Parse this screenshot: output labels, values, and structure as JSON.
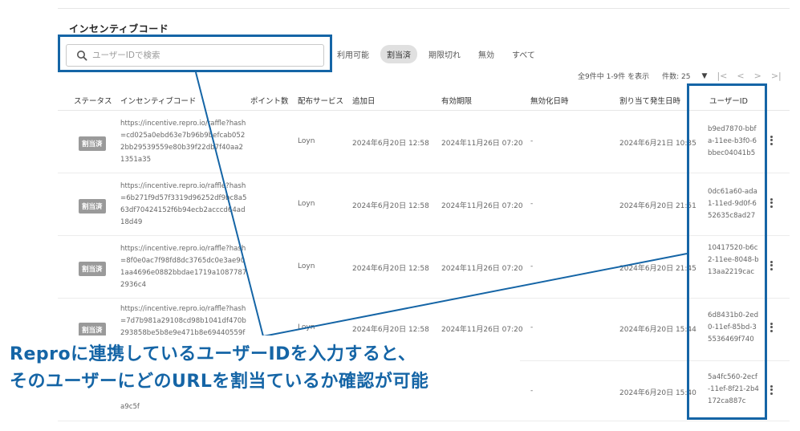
{
  "page": {
    "title": "インセンティブコード"
  },
  "search": {
    "placeholder": "ユーザーIDで検索",
    "value": ""
  },
  "filters": [
    {
      "label": "利用可能",
      "active": false
    },
    {
      "label": "割当済",
      "active": true
    },
    {
      "label": "期限切れ",
      "active": false
    },
    {
      "label": "無効",
      "active": false
    },
    {
      "label": "すべて",
      "active": false
    }
  ],
  "pager": {
    "summary": "全9件中 1-9件 を表示",
    "per_page_label": "件数: 25",
    "dropdown_icon": "chevron-down-icon",
    "first": "|<",
    "prev": "<",
    "next": ">",
    "last": ">|"
  },
  "columns": {
    "status": "ステータス",
    "code": "インセンティブコード",
    "points": "ポイント数",
    "service": "配布サービス",
    "added": "追加日",
    "expiry": "有効期限",
    "disabled": "無効化日時",
    "assigned": "割り当て発生日時",
    "user_id": "ユーザーID"
  },
  "rows": [
    {
      "status": "割当済",
      "url": "https://incentive.repro.io/raffle?hash=cd025a0ebd63e7b96b9befcab0522bb29539559e80b39f22db7f40aa21351a35",
      "points": "",
      "service": "Loyn",
      "added": "2024年6月20日 12:58",
      "expiry": "2024年11月26日 07:20",
      "disabled": "-",
      "assigned": "2024年6月21日 10:35",
      "user_id": "b9ed7870-bbfa-11ee-b3f0-6bbec04041b5"
    },
    {
      "status": "割当済",
      "url": "https://incentive.repro.io/raffle?hash=6b271f9d57f3319d96252df9bc8a563df70424152f6b94ecb2acccd64ad18d49",
      "points": "",
      "service": "Loyn",
      "added": "2024年6月20日 12:58",
      "expiry": "2024年11月26日 07:20",
      "disabled": "-",
      "assigned": "2024年6月20日 21:51",
      "user_id": "0dc61a60-ada1-11ed-9d0f-652635c8ad27"
    },
    {
      "status": "割当済",
      "url": "https://incentive.repro.io/raffle?hash=8f0e0ac7f98fd8dc3765dc0e3ae901aa4696e0882bbdae1719a10877872936c4",
      "points": "",
      "service": "Loyn",
      "added": "2024年6月20日 12:58",
      "expiry": "2024年11月26日 07:20",
      "disabled": "-",
      "assigned": "2024年6月20日 21:45",
      "user_id": "10417520-b6c2-11ee-8048-b13aa2219cac"
    },
    {
      "status": "割当済",
      "url": "https://incentive.repro.io/raffle?hash=7d7b981a29108cd98b1041df470b293858be5b8e9e471b8e69440559f1",
      "points": "",
      "service": "Loyn",
      "added": "2024年6月20日 12:58",
      "expiry": "2024年11月26日 07:20",
      "disabled": "-",
      "assigned": "2024年6月20日 15:44",
      "user_id": "6d8431b0-2ed0-11ef-85bd-35536469f740"
    },
    {
      "status": "",
      "url": "a9c5f",
      "points": "",
      "service": "",
      "added": "",
      "expiry": "",
      "disabled": "-",
      "assigned": "2024年6月20日 15:40",
      "user_id": "5a4fc560-2ecf-11ef-8f21-2b4172ca887c"
    }
  ],
  "annotation": {
    "line1": "Reproに連携しているユーザーIDを入力すると、",
    "line2": "そのユーザーにどのURLを割当ているか確認が可能",
    "color": "#1565a6"
  },
  "colors": {
    "accent": "#1565a6",
    "badge": "#9a9a9a",
    "active_filter": "#e0e0e0"
  }
}
